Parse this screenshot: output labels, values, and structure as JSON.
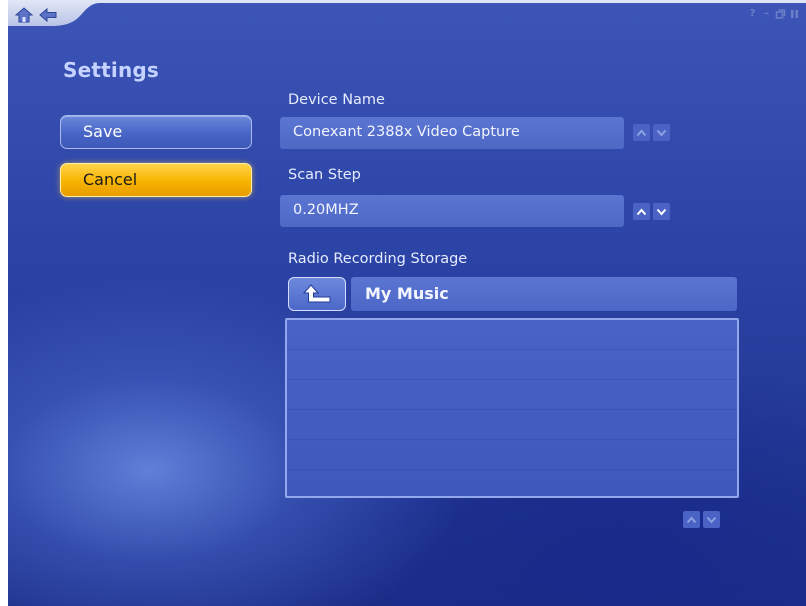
{
  "page": {
    "title": "Settings"
  },
  "window_controls": {
    "help": "?",
    "minimize": "–",
    "restore": "ð",
    "close": "x"
  },
  "actions": {
    "save_label": "Save",
    "cancel_label": "Cancel"
  },
  "device_name": {
    "label": "Device Name",
    "value": "Conexant 2388x Video Capture"
  },
  "scan_step": {
    "label": "Scan Step",
    "value": "0.20MHZ"
  },
  "storage": {
    "label": "Radio Recording Storage",
    "current_folder": "My Music",
    "folders": []
  },
  "icons": {
    "home": "home-icon",
    "back": "back-arrow-icon",
    "up_folder": "up-folder-arrow-icon"
  },
  "colors": {
    "background": "#2c44a6",
    "accent_cancel": "#f8b400",
    "button_blue": "#4a68c8"
  }
}
